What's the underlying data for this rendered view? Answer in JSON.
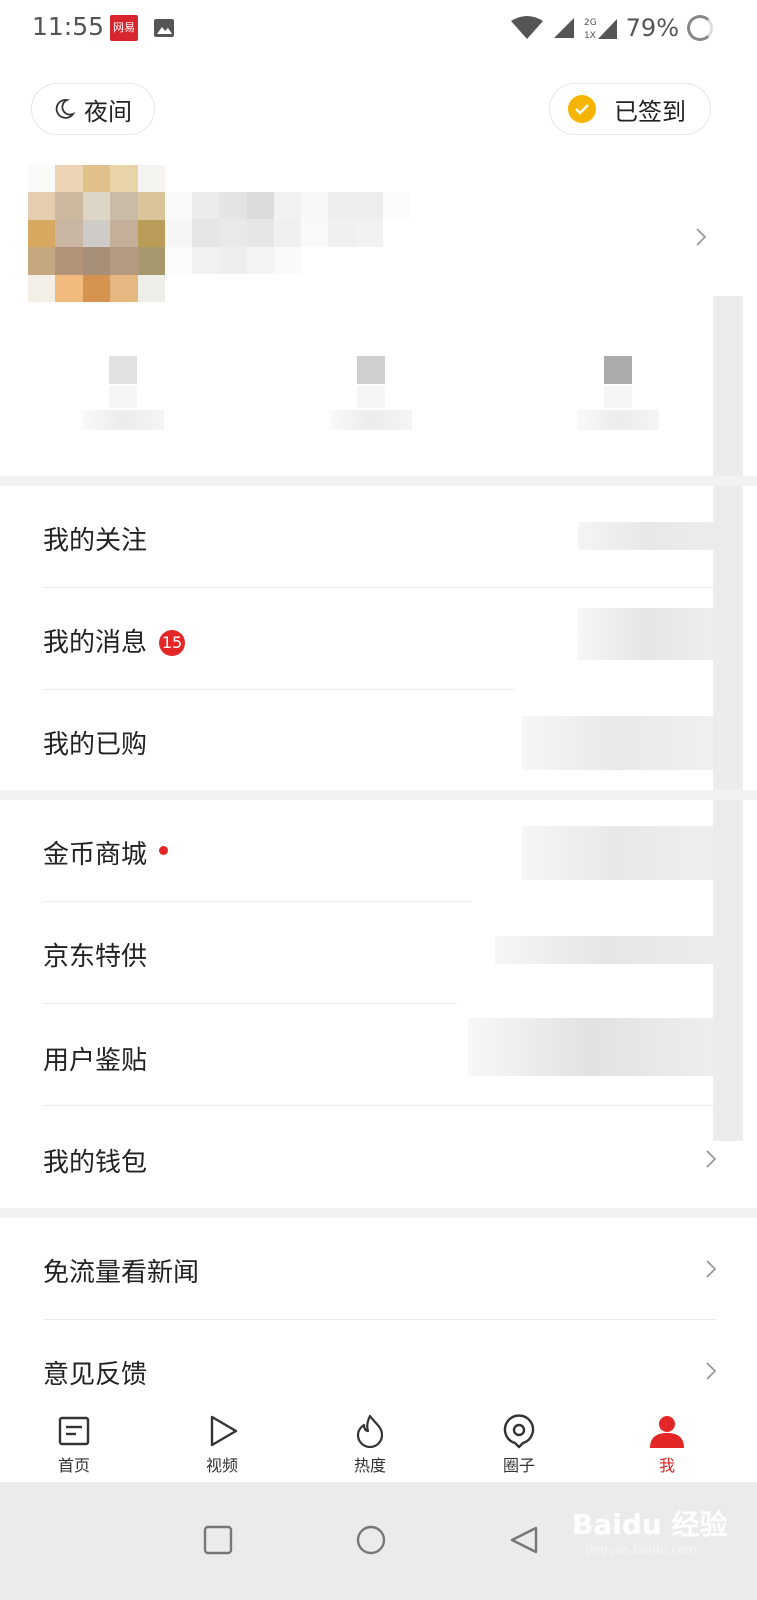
{
  "status_bar": {
    "time": "11:55",
    "app_icon_label": "网易",
    "battery": "79%",
    "icons": [
      "netease-app-icon",
      "gallery-icon",
      "wifi-icon",
      "signal-icon",
      "signal-2g-1x-icon",
      "battery-ring-icon"
    ],
    "signal_2g": "2G",
    "signal_1x": "1X"
  },
  "header": {
    "night_mode_label": "夜间",
    "signed_in_label": "已签到"
  },
  "menu_group_1": [
    {
      "label": "我的关注"
    },
    {
      "label": "我的消息",
      "badge": "15"
    },
    {
      "label": "我的已购"
    }
  ],
  "menu_group_2": [
    {
      "label": "金币商城",
      "dot": true
    },
    {
      "label": "京东特供"
    },
    {
      "label": "用户鉴贴"
    },
    {
      "label": "我的钱包"
    }
  ],
  "menu_group_3": [
    {
      "label": "免流量看新闻"
    },
    {
      "label": "意见反馈"
    }
  ],
  "tabbar": [
    {
      "label": "首页",
      "icon": "home-news-icon"
    },
    {
      "label": "视频",
      "icon": "video-play-icon"
    },
    {
      "label": "热度",
      "icon": "flame-icon"
    },
    {
      "label": "圈子",
      "icon": "circle-icon"
    },
    {
      "label": "我",
      "icon": "profile-icon",
      "active": true
    }
  ],
  "colors": {
    "accent": "#e32626",
    "coin": "#f4b400",
    "divider": "#f2f2f2",
    "nav_bar": "#ebebeb"
  },
  "watermark": {
    "main": "Baidu 经验",
    "sub": "jingyan.baidu.com"
  }
}
